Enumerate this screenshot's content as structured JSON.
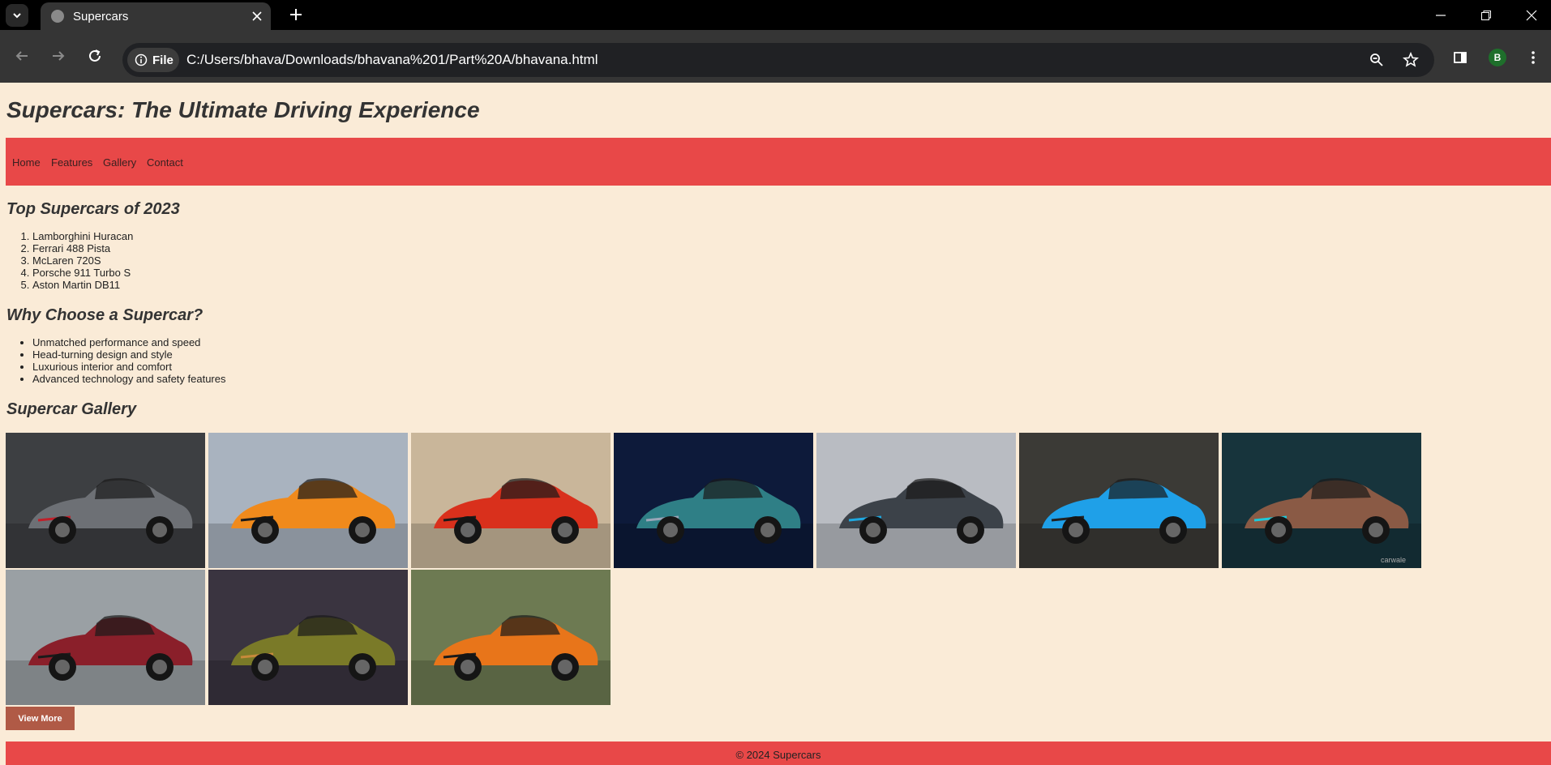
{
  "browser": {
    "tab_title": "Supercars",
    "site_chip_label": "File",
    "url": "C:/Users/bhava/Downloads/bhavana%201/Part%20A/bhavana.html",
    "profile_initial": "B"
  },
  "page": {
    "title": "Supercars: The Ultimate Driving Experience",
    "nav": [
      "Home",
      "Features",
      "Gallery",
      "Contact"
    ],
    "top_heading": "Top Supercars of 2023",
    "top_list": [
      "Lamborghini Huracan",
      "Ferrari 488 Pista",
      "McLaren 720S",
      "Porsche 911 Turbo S",
      "Aston Martin DB11"
    ],
    "why_heading": "Why Choose a Supercar?",
    "why_list": [
      "Unmatched performance and speed",
      "Head-turning design and style",
      "Luxurious interior and comfort",
      "Advanced technology and safety features"
    ],
    "gallery_heading": "Supercar Gallery",
    "gallery": [
      {
        "name": "gallery-image-gray-gtr",
        "bg": "#3d3f42",
        "car": "#6d7075",
        "accent": "#c0202a"
      },
      {
        "name": "gallery-image-orange-mclaren",
        "bg": "#a9b3bf",
        "car": "#f08a1c",
        "accent": "#1b1b1b"
      },
      {
        "name": "gallery-image-red-ferrari",
        "bg": "#c9b69a",
        "car": "#d9301c",
        "accent": "#1b1b1b"
      },
      {
        "name": "gallery-image-teal-valhalla",
        "bg": "#0d1a3a",
        "car": "#2f7f86",
        "accent": "#9aa6b8"
      },
      {
        "name": "gallery-image-gray-divo",
        "bg": "#b9bcc2",
        "car": "#3c4249",
        "accent": "#1fa8e0"
      },
      {
        "name": "gallery-image-blue-koenigsegg",
        "bg": "#3b3a36",
        "car": "#1fa0e8",
        "accent": "#222222"
      },
      {
        "name": "gallery-image-bronze-porsche",
        "bg": "#17343c",
        "car": "#8a5a45",
        "accent": "#1ec8d8",
        "watermark": "carwale"
      },
      {
        "name": "gallery-image-red-pagani",
        "bg": "#9aa0a4",
        "car": "#8a1f2a",
        "accent": "#1b1b1b"
      },
      {
        "name": "gallery-image-gold-lamborghini",
        "bg": "#3a3440",
        "car": "#7a7a28",
        "accent": "#c88a3a"
      },
      {
        "name": "gallery-image-orange-hypercar",
        "bg": "#6d7a52",
        "car": "#e8751a",
        "accent": "#1b1b1b"
      }
    ],
    "view_more_label": "View More",
    "footer": "© 2024 Supercars"
  },
  "colors": {
    "page_bg": "#faebd7",
    "nav_bg": "#e84848",
    "button_bg": "#b05a46",
    "heading_text": "#333333"
  }
}
